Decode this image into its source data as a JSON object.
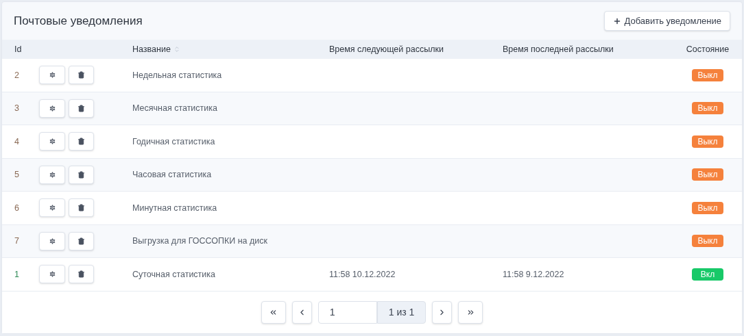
{
  "title": "Почтовые уведомления",
  "add_button": "Добавить уведомление",
  "table": {
    "columns": [
      "Id",
      "Название",
      "Время следующей рассылки",
      "Время последней рассылки",
      "Состояние"
    ],
    "rows": [
      {
        "id": "2",
        "name": "Недельная статистика",
        "on": false,
        "status": "Выкл"
      },
      {
        "id": "3",
        "name": "Месячная статистика",
        "on": false,
        "status": "Выкл"
      },
      {
        "id": "4",
        "name": "Годичная статистика",
        "on": false,
        "status": "Выкл"
      },
      {
        "id": "5",
        "name": "Часовая статистика",
        "on": false,
        "status": "Выкл"
      },
      {
        "id": "6",
        "name": "Минутная статистика",
        "on": false,
        "status": "Выкл"
      },
      {
        "id": "7",
        "name": "Выгрузка для ГОССОПКИ на диск",
        "on": false,
        "status": "Выкл"
      },
      {
        "id": "1",
        "name": "Суточная статистика",
        "next": "11:58 10.12.2022",
        "last": "11:58 9.12.2022",
        "on": true,
        "status": "Вкл"
      }
    ]
  },
  "pagination": {
    "page": "1",
    "summary": "1 из 1"
  }
}
